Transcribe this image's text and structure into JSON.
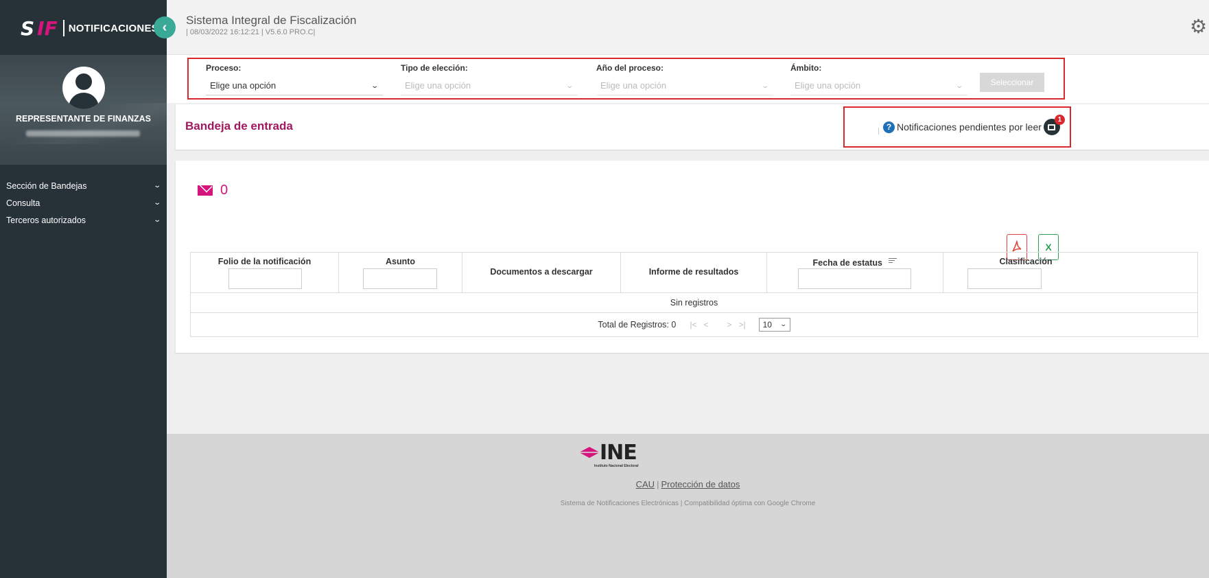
{
  "brand": {
    "logo_s": "S",
    "logo_if": "IF",
    "title": "NOTIFICACIONES"
  },
  "header": {
    "title": "Sistema Integral de Fiscalización",
    "subtitle": "| 08/03/2022 16:12:21 | V5.6.0 PRO.C|"
  },
  "profile": {
    "role": "REPRESENTANTE DE FINANZAS"
  },
  "sidebar": {
    "items": [
      {
        "label": "Sección de Bandejas"
      },
      {
        "label": "Consulta"
      },
      {
        "label": "Terceros autorizados"
      }
    ]
  },
  "filters": {
    "proceso": {
      "label": "Proceso:",
      "value": "Elige una opción"
    },
    "tipo": {
      "label": "Tipo de elección:",
      "value": "Elige una opción"
    },
    "anio": {
      "label": "Año del proceso:",
      "value": "Elige una opción"
    },
    "ambito": {
      "label": "Ámbito:",
      "value": "Elige una opción"
    },
    "button": "Seleccionar"
  },
  "inbox": {
    "title": "Bandeja de entrada",
    "pending_label": "Notificaciones pendientes por leer",
    "pending_count": "1",
    "count": "0"
  },
  "table": {
    "columns": [
      "Folio de la notificación",
      "Asunto",
      "Documentos a descargar",
      "Informe de resultados",
      "Fecha de estatus",
      "Clasificación"
    ],
    "empty_text": "Sin registros",
    "total_label": "Total de Registros: 0",
    "page_size": "10"
  },
  "export": {
    "pdf_icon": "pdf-icon",
    "excel_icon": "excel-icon",
    "excel_glyph": "X"
  },
  "footer": {
    "logo_text": "INE",
    "logo_sub": "Instituto Nacional Electoral",
    "link_cau": "CAU",
    "link_privacy": "Protección de datos",
    "note": "Sistema de Notificaciones Electrónicas | Compatibilidad óptima con Google Chrome"
  },
  "colors": {
    "sidebar": "#263238",
    "accent": "#d5147d",
    "teal": "#3aaa97",
    "alert": "#d9272e"
  }
}
